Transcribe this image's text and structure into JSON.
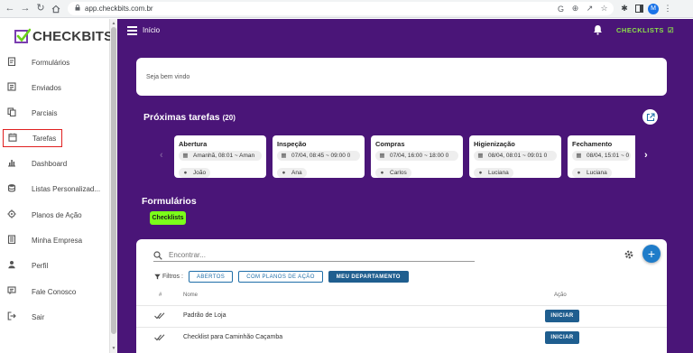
{
  "browser": {
    "url": "app.checkbits.com.br",
    "profile_initial": "M"
  },
  "sidebar": {
    "logo_text": "CHECKBITS",
    "items": [
      {
        "label": "Formulários",
        "icon": "clipboard-icon"
      },
      {
        "label": "Enviados",
        "icon": "list-icon"
      },
      {
        "label": "Parciais",
        "icon": "copy-icon"
      },
      {
        "label": "Tarefas",
        "icon": "calendar-icon"
      },
      {
        "label": "Dashboard",
        "icon": "bar-chart-icon"
      },
      {
        "label": "Listas Personalizad...",
        "icon": "database-icon"
      },
      {
        "label": "Planos de Ação",
        "icon": "target-icon"
      },
      {
        "label": "Minha Empresa",
        "icon": "building-icon"
      },
      {
        "label": "Perfil",
        "icon": "person-icon"
      },
      {
        "label": "Fale Conosco",
        "icon": "chat-icon"
      },
      {
        "label": "Sair",
        "icon": "logout-icon"
      }
    ]
  },
  "header": {
    "title": "Início",
    "checklists_label": "CHECKLISTS"
  },
  "welcome_text": "Seja bem vindo",
  "tasks": {
    "title": "Próximas tarefas",
    "count": "(20)",
    "cards": [
      {
        "title": "Abertura",
        "time": "Amanhã, 08:01 ~ Aman",
        "user": "João"
      },
      {
        "title": "Inspeção",
        "time": "07/04, 08:45 ~ 09:00 0",
        "user": "Ana"
      },
      {
        "title": "Compras",
        "time": "07/04, 16:00 ~ 18:00 0",
        "user": "Carlos"
      },
      {
        "title": "Higienização",
        "time": "08/04, 08:01 ~ 09:01 0",
        "user": "Luciana"
      },
      {
        "title": "Fechamento",
        "time": "08/04, 15:01 ~ 0",
        "user": "Luciana"
      }
    ]
  },
  "forms": {
    "title": "Formulários",
    "chip": "Checklists",
    "search_placeholder": "Encontrar...",
    "filters_label": "Filtros :",
    "filters": [
      "ABERTOS",
      "COM PLANOS DE AÇÃO",
      "MEU DEPARTAMENTO"
    ],
    "columns": {
      "num": "#",
      "name": "Nome",
      "action": "Ação"
    },
    "rows": [
      {
        "name": "Padrão de Loja",
        "action": "INICIAR"
      },
      {
        "name": "Checklist para Caminhão Caçamba",
        "action": "INICIAR"
      }
    ]
  },
  "colors": {
    "main_bg": "#4a1578",
    "accent_green": "#7bff1a",
    "button_blue": "#1f5e8f",
    "fab_blue": "#1f7cc9",
    "active_border": "#e02020"
  }
}
